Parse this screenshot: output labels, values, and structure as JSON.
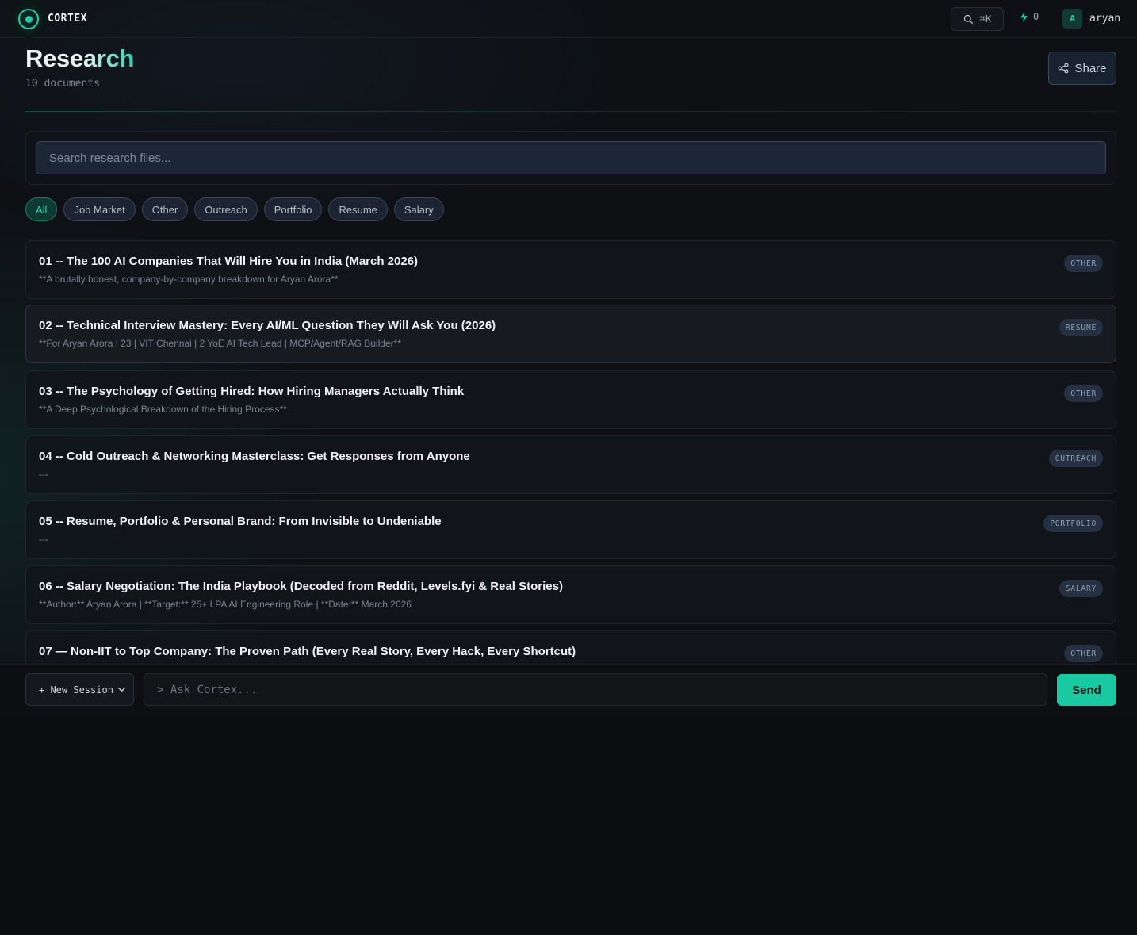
{
  "topbar": {
    "brand": "CORTEX",
    "shortcut": "⌘K",
    "energy_count": "0",
    "avatar_initial": "A",
    "username": "aryan"
  },
  "header": {
    "title": "Research",
    "doc_count": "10 documents",
    "share_label": "Share"
  },
  "search": {
    "placeholder": "Search research files..."
  },
  "filters": [
    "All",
    "Job Market",
    "Other",
    "Outreach",
    "Portfolio",
    "Resume",
    "Salary"
  ],
  "active_filter": "All",
  "documents": [
    {
      "title": "01 -- The 100 AI Companies That Will Hire You in India (March 2026)",
      "subtitle": "**A brutally honest, company-by-company breakdown for Aryan Arora**",
      "tag": "OTHER"
    },
    {
      "title": "02 -- Technical Interview Mastery: Every AI/ML Question They Will Ask You (2026)",
      "subtitle": "**For Aryan Arora | 23 | VIT Chennai | 2 YoE AI Tech Lead | MCP/Agent/RAG Builder**",
      "tag": "RESUME"
    },
    {
      "title": "03 -- The Psychology of Getting Hired: How Hiring Managers Actually Think",
      "subtitle": "**A Deep Psychological Breakdown of the Hiring Process**",
      "tag": "OTHER"
    },
    {
      "title": "04 -- Cold Outreach & Networking Masterclass: Get Responses from Anyone",
      "subtitle": "---",
      "tag": "OUTREACH"
    },
    {
      "title": "05 -- Resume, Portfolio & Personal Brand: From Invisible to Undeniable",
      "subtitle": "---",
      "tag": "PORTFOLIO"
    },
    {
      "title": "06 -- Salary Negotiation: The India Playbook (Decoded from Reddit, Levels.fyi & Real Stories)",
      "subtitle": "**Author:** Aryan Arora | **Target:** 25+ LPA AI Engineering Role | **Date:** March 2026",
      "tag": "SALARY"
    },
    {
      "title": "07 — Non-IIT to Top Company: The Proven Path (Every Real Story, Every Hack, Every Shortcut)",
      "subtitle": "",
      "tag": "OTHER"
    }
  ],
  "bottombar": {
    "session_label": "+ New Session",
    "ask_placeholder": "> Ask Cortex...",
    "send_label": "Send"
  },
  "colors": {
    "accent": "#22c9a5",
    "background": "#0e1014",
    "tag_bg": "#253043"
  },
  "icons": {
    "logo": "cortex-logo-icon",
    "search": "search-icon",
    "energy": "lightning-icon",
    "share": "share-icon",
    "dropdown": "chevron-down-icon"
  }
}
